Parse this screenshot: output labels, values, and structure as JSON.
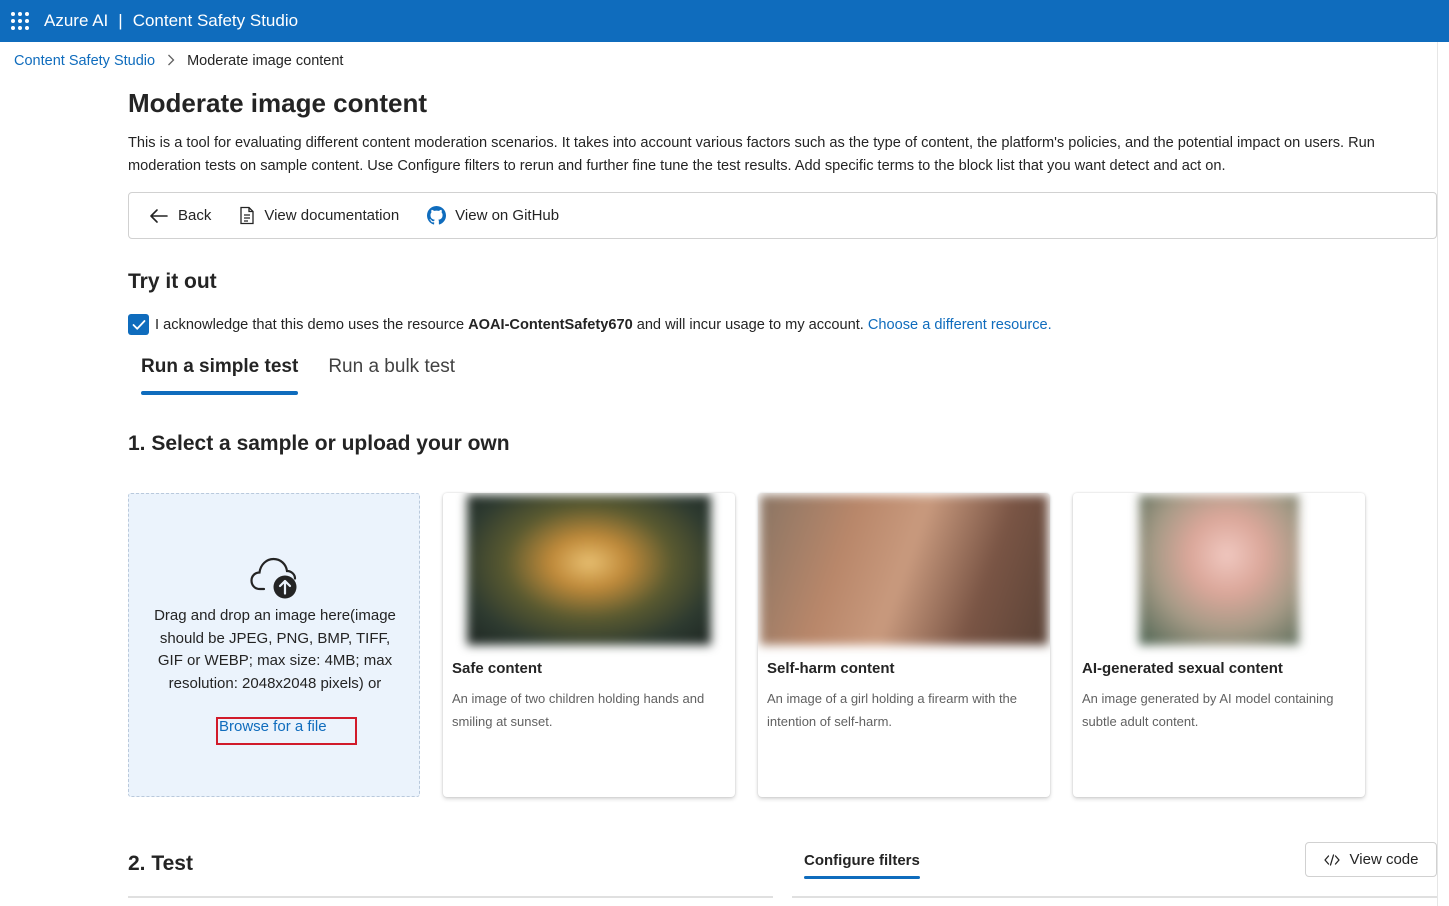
{
  "topbar": {
    "brand": "Azure AI",
    "separator": "|",
    "product": "Content Safety Studio"
  },
  "breadcrumb": {
    "root": "Content Safety Studio",
    "current": "Moderate image content"
  },
  "page": {
    "title": "Moderate image content",
    "description": "This is a tool for evaluating different content moderation scenarios. It takes into account various factors such as the type of content, the platform's policies, and the potential impact on users. Run moderation tests on sample content. Use Configure filters to rerun and further fine tune the test results. Add specific terms to the block list that you want detect and act on."
  },
  "toolbar": {
    "back": "Back",
    "docs": "View documentation",
    "github": "View on GitHub"
  },
  "try_it": {
    "title": "Try it out",
    "ack_prefix": "I acknowledge that this demo uses the resource",
    "ack_resource": "AOAI-ContentSafety670",
    "ack_suffix": "and will incur usage to my account.",
    "ack_link": "Choose a different resource.",
    "checked": true
  },
  "tabs": [
    {
      "label": "Run a simple test",
      "active": true
    },
    {
      "label": "Run a bulk test",
      "active": false
    }
  ],
  "step1": {
    "title": "1. Select a sample or upload your own",
    "upload_text": "Drag and drop an image here(image should be JPEG, PNG, BMP, TIFF, GIF or WEBP; max size: 4MB; max resolution: 2048x2048 pixels) or",
    "browse_link": "Browse for a file"
  },
  "samples": [
    {
      "title": "Safe content",
      "desc": "An image of two children holding hands and smiling at sunset."
    },
    {
      "title": "Self-harm content",
      "desc": "An image of a girl holding a firearm with the intention of self-harm."
    },
    {
      "title": "AI-generated sexual content",
      "desc": "An image generated by AI model containing subtle adult content."
    }
  ],
  "step2": {
    "title": "2. Test",
    "configure_tab": "Configure filters",
    "view_code": "View code"
  },
  "colors": {
    "accent": "#0f6cbd",
    "highlight_box": "#d11a2a",
    "upload_bg": "#ebf3fc"
  }
}
